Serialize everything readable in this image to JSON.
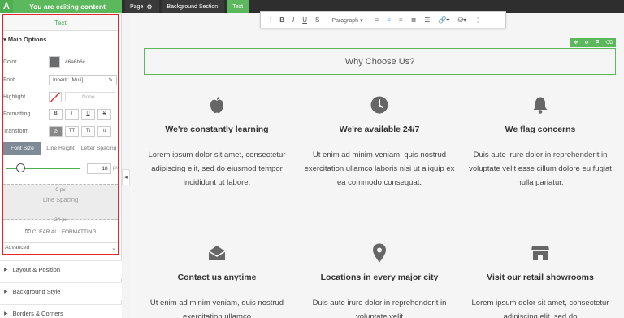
{
  "topbar": {
    "logo": "A",
    "editing_label": "You are editing content",
    "breadcrumbs": [
      "Page",
      "Background Section",
      "Text"
    ]
  },
  "sidebar": {
    "title": "Text",
    "section": "Main Options",
    "color_label": "Color",
    "color_value": "#6a6b6c",
    "font_label": "Font",
    "font_value": "Inherit: [Muli]",
    "highlight_label": "Highlight",
    "highlight_value": "None",
    "formatting_label": "Formatting",
    "formatting_buttons": [
      "B",
      "I",
      "U",
      "S"
    ],
    "transform_label": "Transform",
    "transform_buttons": [
      "⊘",
      "TT",
      "Tt",
      "tt"
    ],
    "tabs": [
      "Font Size",
      "Line Height",
      "Letter Spacing"
    ],
    "font_size_value": "18",
    "font_size_unit": "px",
    "spacing_top": "0 px",
    "spacing_label": "Line Spacing",
    "spacing_bottom": "24 px",
    "clear_all": "CLEAR ALL FORMATTING",
    "advanced": "Advanced",
    "accordions": [
      "Layout & Position",
      "Background Style",
      "Borders & Corners"
    ]
  },
  "toolbar": {
    "paragraph": "Paragraph"
  },
  "canvas": {
    "heading": "Why Choose Us?",
    "features": [
      {
        "title": "We're constantly learning",
        "text": "Lorem ipsum dolor sit amet, consectetur adipiscing elit, sed do eiusmod tempor incididunt ut labore."
      },
      {
        "title": "We're available 24/7",
        "text": "Ut enim ad minim veniam, quis nostrud exercitation ullamco laboris nisi ut aliquip ex ea commodo consequat."
      },
      {
        "title": "We flag concerns",
        "text": "Duis aute irure dolor in reprehenderit in voluptate velit esse cillum dolore eu fugiat nulla pariatur."
      },
      {
        "title": "Contact us anytime",
        "text": "Ut enim ad minim veniam, quis nostrud exercitation ullamco"
      },
      {
        "title": "Locations in every major city",
        "text": "Duis aute irure dolor in reprehenderit in voluptate velit"
      },
      {
        "title": "Visit our retail showrooms",
        "text": "Lorem ipsum dolor sit amet, consectetur adipiscing elit, sed do"
      }
    ]
  },
  "colors": {
    "accent_green": "#5cb85c",
    "highlight_red": "#e3262d",
    "text_color": "#6a6b6c"
  }
}
